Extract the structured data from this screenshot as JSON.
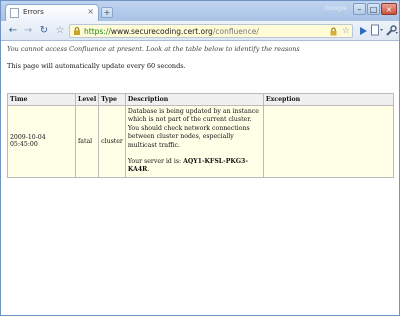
{
  "window": {
    "tab_title": "Errors",
    "tab_close": "×",
    "new_tab": "+",
    "brand": "Google",
    "min": "–",
    "max": "□",
    "close": "×"
  },
  "toolbar": {
    "back": "←",
    "forward": "→",
    "reload": "↻",
    "star": "☆",
    "url_scheme": "https://",
    "url_host": "www.securecoding.cert.org",
    "url_path": "/confluence/",
    "omni_star": "☆"
  },
  "icons": {
    "lock": "lock-icon",
    "page-menu": "page-menu-icon",
    "wrench": "wrench-icon",
    "play": "play-icon"
  },
  "colors": {
    "omnibox_bg": "#fffbd6",
    "https_green": "#1a8a1a",
    "table_cell_bg": "#ffffe8",
    "table_header_bg": "#f0f0f0"
  },
  "page": {
    "notice": "You cannot access Confluence at present. Look at the table below to identify the reasons",
    "autoupdate": "This page will automatically update every 60 seconds."
  },
  "table": {
    "headers": {
      "time": "Time",
      "level": "Level",
      "type": "Type",
      "description": "Description",
      "exception": "Exception"
    },
    "rows": [
      {
        "time": "2009-10-04 05:45:00",
        "level": "fatal",
        "type": "cluster",
        "description": "Database is being updated by an instance which is not part of the current cluster. You should check network connections between cluster nodes, especially multicast traffic.",
        "server_id_label": "Your server id is:",
        "server_id": "AQY1-KFSL-PKG3-KA4R",
        "server_id_suffix": ".",
        "exception": ""
      }
    ]
  }
}
